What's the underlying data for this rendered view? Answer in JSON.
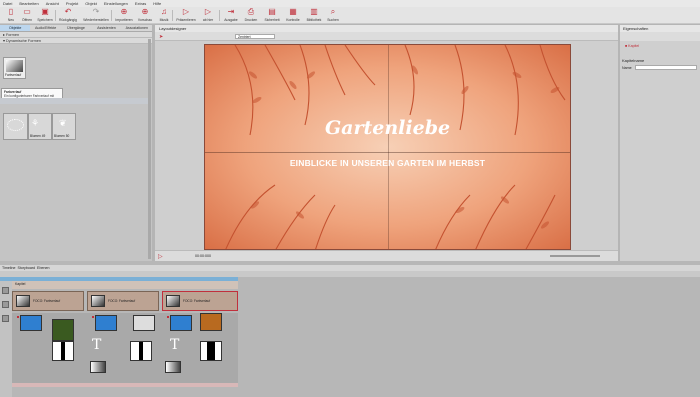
{
  "menu": [
    "Datei",
    "Bearbeiten",
    "Ansicht",
    "Projekt",
    "Objekt",
    "Einstellungen",
    "Extras",
    "Hilfe"
  ],
  "toolbar": [
    {
      "label": "Neu",
      "icon": "new-file-icon"
    },
    {
      "label": "Öffnen",
      "icon": "open-folder-icon"
    },
    {
      "label": "Speichern",
      "icon": "save-icon"
    },
    {
      "label": "Rückgängig",
      "icon": "undo-icon"
    },
    {
      "label": "Wiederherstellen",
      "icon": "redo-icon"
    },
    {
      "label": "Importieren",
      "icon": "import-icon"
    },
    {
      "label": "Vorschau",
      "icon": "plus-icon"
    },
    {
      "label": "Musik",
      "icon": "music-icon"
    },
    {
      "label": "Präsentieren",
      "icon": "play-icon"
    },
    {
      "label": "ab hier",
      "icon": "play-from-icon"
    },
    {
      "label": "Ausgabe",
      "icon": "export-icon"
    },
    {
      "label": "Drucken",
      "icon": "print-icon"
    },
    {
      "label": "Sicherheit",
      "icon": "lock-icon"
    },
    {
      "label": "Kontrolle",
      "icon": "check-icon"
    },
    {
      "label": "Bibliothek",
      "icon": "library-icon"
    },
    {
      "label": "Suchen",
      "icon": "search-icon"
    }
  ],
  "left_panel": {
    "tabs": [
      "Objekte",
      "Audio/Effekte",
      "Übergänge",
      "Assistenten",
      "Assoziationen"
    ],
    "tree_items": [
      "Formen",
      "Dynamische Formen"
    ],
    "tile_label": "Farbverlauf",
    "tooltip": "Ein konfigurierbarer Farbverlauf mit verschiedenen Einstellungen",
    "tiles2": [
      "Blumen 49",
      "Blumen 50"
    ]
  },
  "preview": {
    "title": "Layoutdesigner",
    "zoom": "Zentriert",
    "canvas_title": "Gartenliebe",
    "canvas_subtitle": "EINBLICKE IN UNSEREN GARTEN IM HERBST",
    "time": "00:00:000"
  },
  "props": {
    "title": "Eigenschaften",
    "chapter_label": "Kapitel",
    "section": "Kapitelname",
    "name_label": "Name"
  },
  "timeline": {
    "tabs": [
      "Timeline",
      "Storyboard",
      "Ebenen"
    ],
    "chapter": "Kapitel",
    "clips": [
      "FOCO: Farbverlauf",
      "FOCO: Farbverlauf"
    ]
  },
  "colors": {
    "accent": "#c0303c",
    "canvas_center": "#f7d0b6",
    "canvas_edge": "#d96f46",
    "leaf": "#c45230"
  }
}
